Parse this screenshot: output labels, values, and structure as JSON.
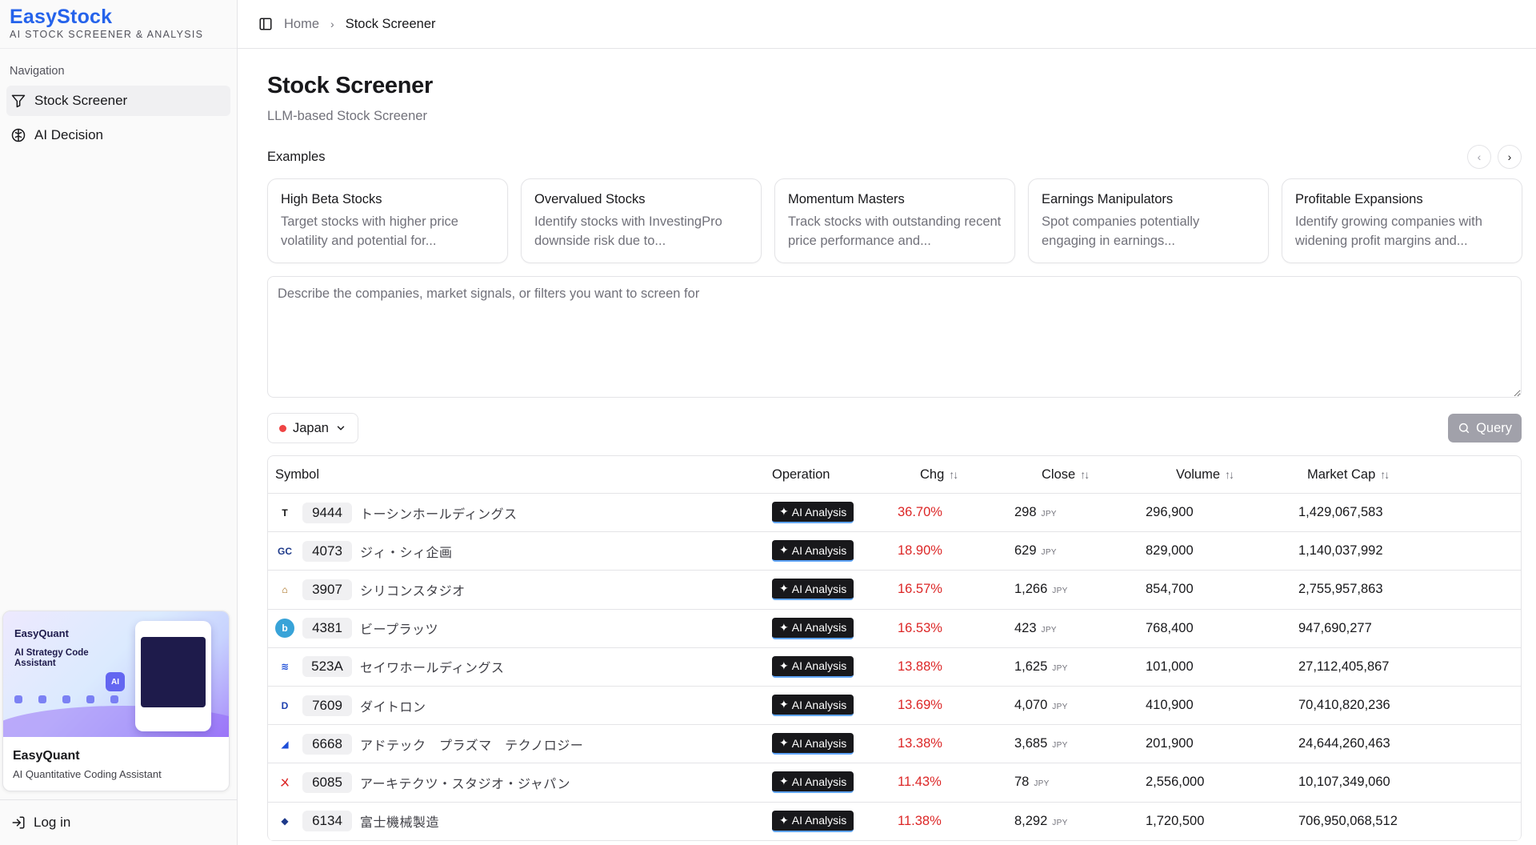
{
  "brand": {
    "name": "EasyStock",
    "tagline": "AI STOCK SCREENER & ANALYSIS"
  },
  "nav": {
    "title": "Navigation",
    "items": [
      {
        "label": "Stock Screener",
        "icon": "filter-icon",
        "active": true
      },
      {
        "label": "AI Decision",
        "icon": "brain-icon",
        "active": false
      }
    ]
  },
  "promo": {
    "image_brand": "EasyQuant",
    "image_title": "AI Strategy Code Assistant",
    "image_badge": "AI",
    "name": "EasyQuant",
    "subtitle": "AI Quantitative Coding Assistant"
  },
  "login_label": "Log in",
  "breadcrumb": {
    "home": "Home",
    "current": "Stock Screener"
  },
  "page": {
    "title": "Stock Screener",
    "subtitle": "LLM-based Stock Screener"
  },
  "examples": {
    "label": "Examples",
    "cards": [
      {
        "title": "High Beta Stocks",
        "desc": "Target stocks with higher price volatility and potential for..."
      },
      {
        "title": "Overvalued Stocks",
        "desc": "Identify stocks with InvestingPro downside risk due to..."
      },
      {
        "title": "Momentum Masters",
        "desc": "Track stocks with outstanding recent price performance and..."
      },
      {
        "title": "Earnings Manipulators",
        "desc": "Spot companies potentially engaging in earnings..."
      },
      {
        "title": "Profitable Expansions",
        "desc": "Identify growing companies with widening profit margins and..."
      }
    ]
  },
  "prompt": {
    "placeholder": "Describe the companies, market signals, or filters you want to screen for",
    "value": ""
  },
  "country": {
    "selected": "Japan"
  },
  "query_label": "Query",
  "table": {
    "headers": {
      "symbol": "Symbol",
      "operation": "Operation",
      "chg": "Chg",
      "close": "Close",
      "volume": "Volume",
      "market_cap": "Market Cap"
    },
    "ai_label": "AI Analysis",
    "currency": "JPY",
    "rows": [
      {
        "code": "9444",
        "name": "トーシンホールディングス",
        "chg": "36.70%",
        "close": "298",
        "volume": "296,900",
        "cap": "1,429,067,583",
        "logo": "T",
        "logo_color": "#111111",
        "logo_bg": "#ffffff"
      },
      {
        "code": "4073",
        "name": "ジィ・シィ企画",
        "chg": "18.90%",
        "close": "629",
        "volume": "829,000",
        "cap": "1,140,037,992",
        "logo": "GC",
        "logo_color": "#1e3a8a",
        "logo_bg": "#ffffff"
      },
      {
        "code": "3907",
        "name": "シリコンスタジオ",
        "chg": "16.57%",
        "close": "1,266",
        "volume": "854,700",
        "cap": "2,755,957,863",
        "logo": "⌂",
        "logo_color": "#a16207",
        "logo_bg": "#ffffff"
      },
      {
        "code": "4381",
        "name": "ビープラッツ",
        "chg": "16.53%",
        "close": "423",
        "volume": "768,400",
        "cap": "947,690,277",
        "logo": "b",
        "logo_color": "#ffffff",
        "logo_bg": "#38a3d8"
      },
      {
        "code": "523A",
        "name": "セイワホールディングス",
        "chg": "13.88%",
        "close": "1,625",
        "volume": "101,000",
        "cap": "27,112,405,867",
        "logo": "≋",
        "logo_color": "#1d4ed8",
        "logo_bg": "#ffffff"
      },
      {
        "code": "7609",
        "name": "ダイトロン",
        "chg": "13.69%",
        "close": "4,070",
        "volume": "410,900",
        "cap": "70,410,820,236",
        "logo": "D",
        "logo_color": "#1e40af",
        "logo_bg": "#ffffff"
      },
      {
        "code": "6668",
        "name": "アドテック　プラズマ　テクノロジー",
        "chg": "13.38%",
        "close": "3,685",
        "volume": "201,900",
        "cap": "24,644,260,463",
        "logo": "◢",
        "logo_color": "#1d4ed8",
        "logo_bg": "#ffffff"
      },
      {
        "code": "6085",
        "name": "アーキテクツ・スタジオ・ジャパン",
        "chg": "11.43%",
        "close": "78",
        "volume": "2,556,000",
        "cap": "10,107,349,060",
        "logo": "ㄨ",
        "logo_color": "#dc2626",
        "logo_bg": "#ffffff"
      },
      {
        "code": "6134",
        "name": "富士機械製造",
        "chg": "11.38%",
        "close": "8,292",
        "volume": "1,720,500",
        "cap": "706,950,068,512",
        "logo": "◆",
        "logo_color": "#1e3a8a",
        "logo_bg": "#ffffff"
      }
    ]
  }
}
